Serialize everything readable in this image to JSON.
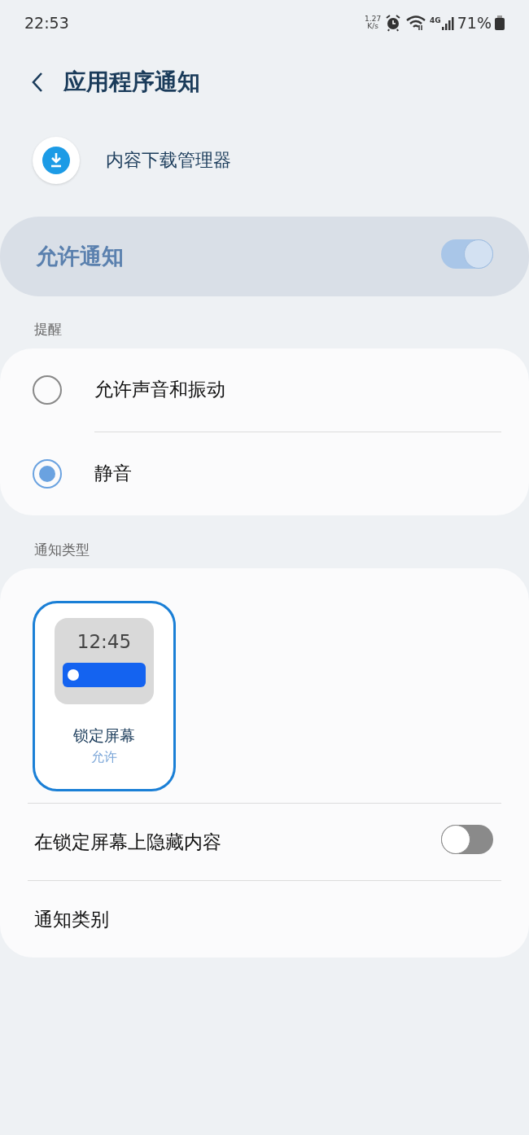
{
  "status_bar": {
    "time": "22:53",
    "net_speed": "1.27",
    "net_unit": "K/s",
    "network": "4G",
    "battery": "71%"
  },
  "header": {
    "title": "应用程序通知"
  },
  "app": {
    "name": "内容下载管理器"
  },
  "allow_notifications": {
    "label": "允许通知",
    "on": true
  },
  "alerts": {
    "heading": "提醒",
    "options": [
      {
        "label": "允许声音和振动",
        "selected": false
      },
      {
        "label": "静音",
        "selected": true
      }
    ]
  },
  "notification_types": {
    "heading": "通知类型",
    "types": [
      {
        "preview_time": "12:45",
        "label": "锁定屏幕",
        "status": "允许",
        "selected": true
      }
    ],
    "settings": [
      {
        "kind": "toggle",
        "label": "在锁定屏幕上隐藏内容",
        "on": false
      },
      {
        "kind": "link",
        "label": "通知类别"
      }
    ]
  }
}
